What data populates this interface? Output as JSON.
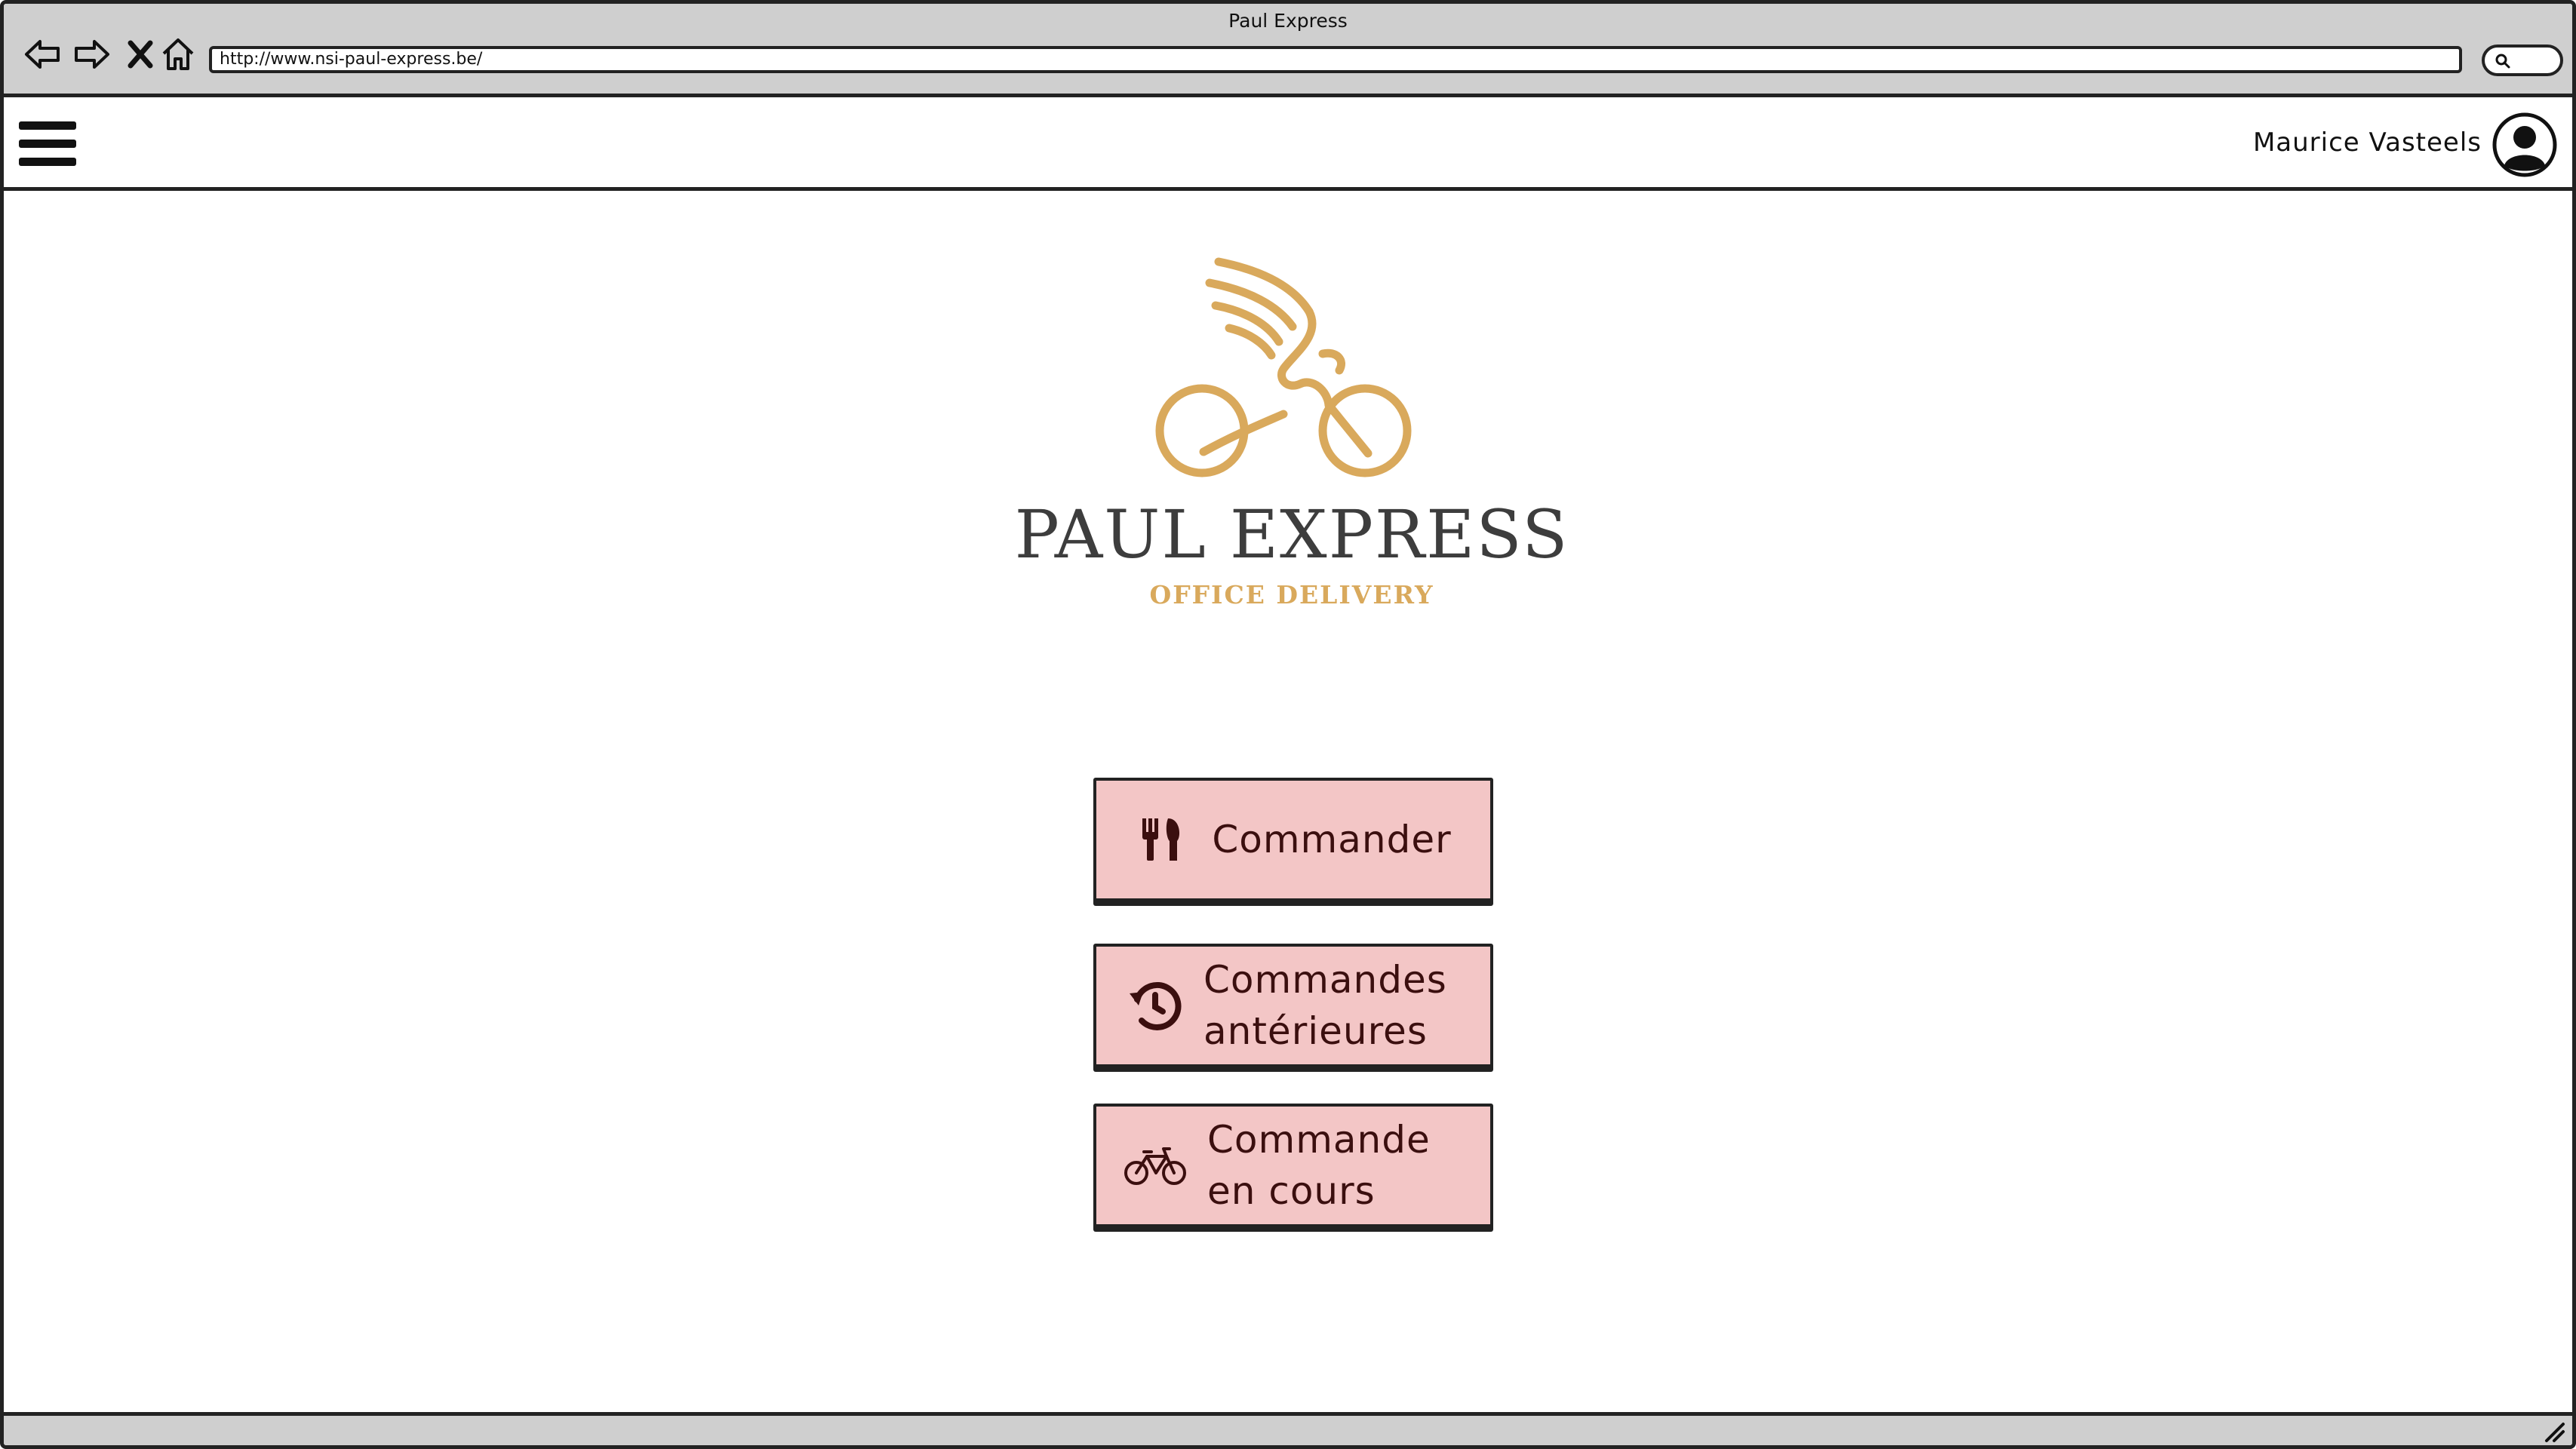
{
  "browser": {
    "window_title": "Paul Express",
    "url": "http://www.nsi-paul-express.be/"
  },
  "header": {
    "user_name": "Maurice Vasteels"
  },
  "brand": {
    "name": "PAUL EXPRESS",
    "tagline": "OFFICE DELIVERY",
    "logo_color": "#d9a95c"
  },
  "actions": {
    "order": {
      "label": "Commander",
      "icon": "fork-knife-icon"
    },
    "history": {
      "label": "Commandes antérieures",
      "icon": "history-icon"
    },
    "current": {
      "label": "Commande en cours",
      "icon": "bicycle-icon"
    }
  },
  "colors": {
    "button_fill": "#f3c6c6",
    "button_text": "#3b0f0f",
    "chrome": "#cfcfcf"
  }
}
